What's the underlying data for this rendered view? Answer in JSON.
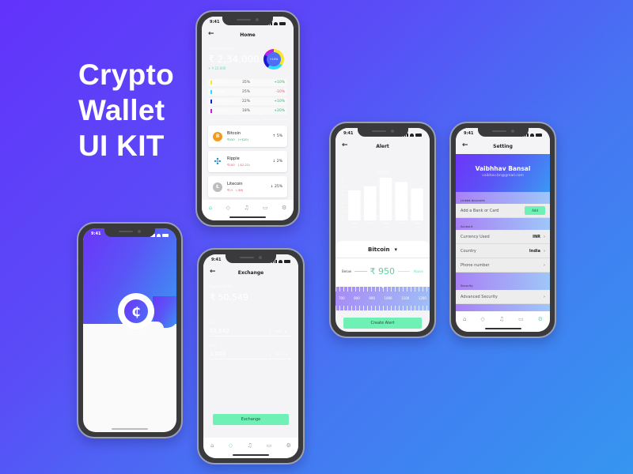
{
  "headline": [
    "Crypto",
    "Wallet",
    "UI KIT"
  ],
  "status_time": "9:41",
  "nav_icons": [
    "home-icon",
    "tag-icon",
    "bell-icon",
    "wallet-icon",
    "gear-icon"
  ],
  "nav_glyphs": [
    "⌂",
    "◇",
    "♫",
    "▭",
    "⚙"
  ],
  "colors": {
    "accent_green": "#6ff1b6",
    "gradient_start": "#6c35fa",
    "gradient_end": "#3a98f3",
    "up": "#2fb36a",
    "down": "#e0566b"
  },
  "splash": {
    "logo_glyph": "₵"
  },
  "home": {
    "title": "Home",
    "back_glyph": "←",
    "wallet_label": "Wallet Balance",
    "wallet_value": "₹ 2,34,000",
    "wallet_change": "+ ₹ 22,000",
    "donut_label": "+10%",
    "allocations": [
      {
        "name": "Bitcoin",
        "pct": "35%",
        "change": "+10%",
        "dir": "up",
        "color": "#f7e62a",
        "share": 35
      },
      {
        "name": "Ripple",
        "pct": "25%",
        "change": "-10%",
        "dir": "down",
        "color": "#35d9f5",
        "share": 25
      },
      {
        "name": "Ethereum",
        "pct": "22%",
        "change": "+10%",
        "dir": "up",
        "color": "#1a18d6",
        "share": 22
      },
      {
        "name": "Litecoin",
        "pct": "18%",
        "change": "+20%",
        "dir": "up",
        "color": "#c41ee0",
        "share": 18
      }
    ],
    "section_label": "24 Hrs Change",
    "coins": [
      {
        "name": "Bitcoin",
        "price": "₹450",
        "delta": "(+$20)",
        "trend": "↑ 5%",
        "dir": "up",
        "icon": "B",
        "icon_color": "#f39a1e"
      },
      {
        "name": "Ripple",
        "price": "₹100",
        "delta": "(-$2.22)",
        "trend": "↓ 2%",
        "dir": "down",
        "icon": "✣",
        "icon_color": "#2490c9"
      },
      {
        "name": "Litecoin",
        "price": "₹21",
        "delta": "(-$6)",
        "trend": "↓ 25%",
        "dir": "down",
        "icon": "Ł",
        "icon_color": "#bdbdbd"
      }
    ]
  },
  "exchange": {
    "title": "Exchange",
    "back_glyph": "←",
    "wallet_label": "Rupee Wallet",
    "wallet_value": "₹ 50,549",
    "sell_label": "Sell",
    "sell_value": "50,549",
    "sell_currency": "INR",
    "buy_label": "Buy",
    "buy_value": "1,000",
    "buy_currency": "BCH",
    "dropdown_glyph": "▾",
    "button_label": "Exchange"
  },
  "alert": {
    "title": "Alert",
    "back_glyph": "←",
    "chart_title": "Bit Coin",
    "coin_label": "Bitcoin",
    "dropdown_glyph": "▾",
    "below_label": "Below",
    "above_label": "Above",
    "alert_value": "₹ 950",
    "ruler_labels": [
      "700",
      "800",
      "900",
      "1000",
      "1100",
      "1200"
    ],
    "button_label": "Create Alert"
  },
  "chart_data": {
    "type": "bar",
    "title": "Bit Coin",
    "categories": [
      "",
      "",
      "",
      "",
      ""
    ],
    "values": [
      70,
      80,
      100,
      90,
      75
    ],
    "ylim": [
      0,
      100
    ],
    "grid": true,
    "xlabel": "",
    "ylabel": ""
  },
  "settings": {
    "title": "Setting",
    "back_glyph": "←",
    "user_name": "Vaibhhav Bansal",
    "user_email": "vaibhav.bn@gmail.com",
    "linked_label": "Linked Accounts",
    "add_bank_label": "Add a Bank or Card",
    "add_button": "Add",
    "account_label": "Account",
    "rows": [
      {
        "label": "Currency Used",
        "value": "INR"
      },
      {
        "label": "Country",
        "value": "India"
      },
      {
        "label": "Phone number",
        "value": ""
      }
    ],
    "security_label": "Security",
    "security_row": "Advanced Security",
    "chevron": "›"
  }
}
